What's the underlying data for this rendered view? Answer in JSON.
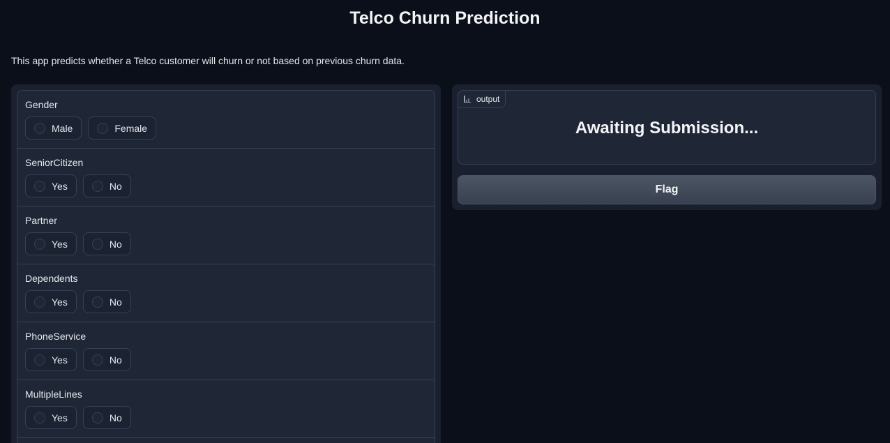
{
  "header": {
    "title": "Telco Churn Prediction",
    "description": "This app predicts whether a Telco customer will churn or not based on previous churn data."
  },
  "inputs": {
    "fields": [
      {
        "label": "Gender",
        "options": [
          "Male",
          "Female"
        ]
      },
      {
        "label": "SeniorCitizen",
        "options": [
          "Yes",
          "No"
        ]
      },
      {
        "label": "Partner",
        "options": [
          "Yes",
          "No"
        ]
      },
      {
        "label": "Dependents",
        "options": [
          "Yes",
          "No"
        ]
      },
      {
        "label": "PhoneService",
        "options": [
          "Yes",
          "No"
        ]
      },
      {
        "label": "MultipleLines",
        "options": [
          "Yes",
          "No"
        ]
      }
    ]
  },
  "output": {
    "label": "output",
    "icon": "bar-chart-icon",
    "value": "Awaiting Submission..."
  },
  "actions": {
    "flag_label": "Flag"
  },
  "colors": {
    "background": "#0b0f19",
    "panel": "#1a2030",
    "block": "#1f2737",
    "border": "#374151",
    "button": "#4b5563"
  }
}
